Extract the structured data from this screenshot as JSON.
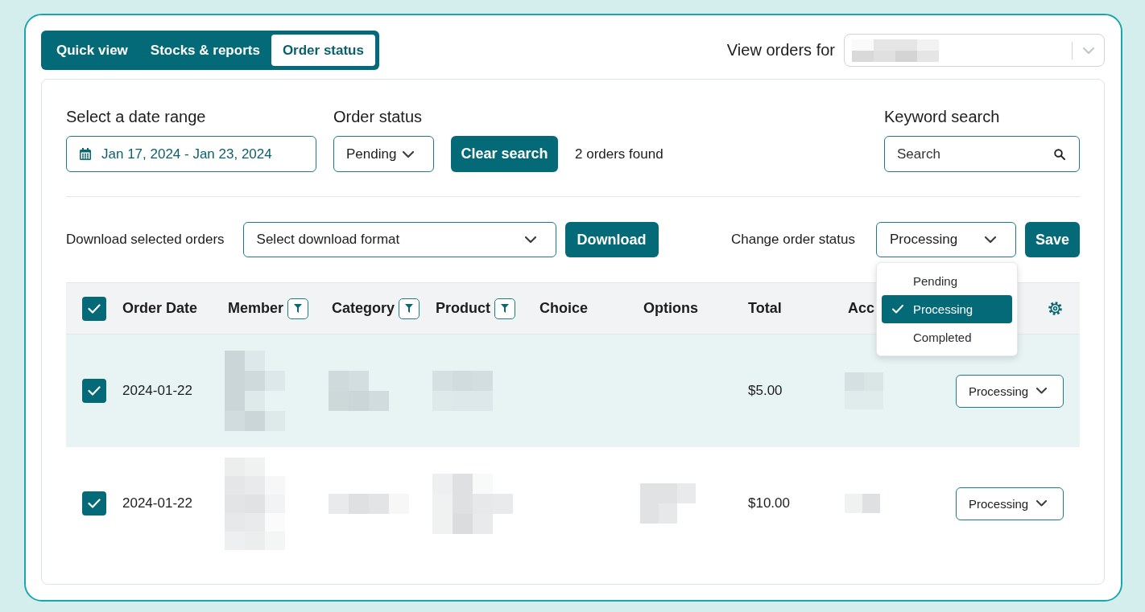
{
  "tabs": [
    {
      "label": "Quick view",
      "selected": false
    },
    {
      "label": "Stocks & reports",
      "selected": false
    },
    {
      "label": "Order status",
      "selected": true
    }
  ],
  "view_orders_for": {
    "label": "View orders for",
    "value_redacted": true
  },
  "filters": {
    "date_range": {
      "label": "Select a date range",
      "value": "Jan 17, 2024 - Jan 23, 2024"
    },
    "order_status": {
      "label": "Order status",
      "value": "Pending"
    },
    "clear_button": "Clear search",
    "result_count": "2 orders found",
    "keyword_search": {
      "label": "Keyword search",
      "placeholder": "Search"
    }
  },
  "actions": {
    "download_label": "Download selected orders",
    "format_select": {
      "value": "Select download format"
    },
    "download_button": "Download",
    "change_status_label": "Change order status",
    "status_select": {
      "value": "Processing",
      "expanded": true,
      "options": [
        {
          "label": "Pending",
          "selected": false
        },
        {
          "label": "Processing",
          "selected": true
        },
        {
          "label": "Completed",
          "selected": false
        }
      ]
    },
    "save_button": "Save"
  },
  "table": {
    "all_checked": true,
    "columns": [
      {
        "label": "Order Date",
        "filter": false
      },
      {
        "label": "Member",
        "filter": true
      },
      {
        "label": "Category",
        "filter": true
      },
      {
        "label": "Product",
        "filter": true
      },
      {
        "label": "Choice",
        "filter": false
      },
      {
        "label": "Options",
        "filter": false
      },
      {
        "label": "Total",
        "filter": false
      },
      {
        "label": "Acc",
        "filter": false
      }
    ],
    "rows": [
      {
        "checked": true,
        "highlighted": true,
        "cells": [
          {
            "kind": "text",
            "text": "2024-01-22"
          },
          {
            "kind": "redacted"
          },
          {
            "kind": "redacted"
          },
          {
            "kind": "redacted"
          },
          {
            "kind": "blank"
          },
          {
            "kind": "blank"
          },
          {
            "kind": "text",
            "text": "$5.00"
          },
          {
            "kind": "redacted"
          }
        ],
        "status": "Processing"
      },
      {
        "checked": true,
        "highlighted": false,
        "cells": [
          {
            "kind": "text",
            "text": "2024-01-22"
          },
          {
            "kind": "redacted"
          },
          {
            "kind": "redacted"
          },
          {
            "kind": "redacted"
          },
          {
            "kind": "blank"
          },
          {
            "kind": "redacted"
          },
          {
            "kind": "text",
            "text": "$10.00"
          },
          {
            "kind": "redacted"
          }
        ],
        "status": "Processing"
      }
    ]
  }
}
